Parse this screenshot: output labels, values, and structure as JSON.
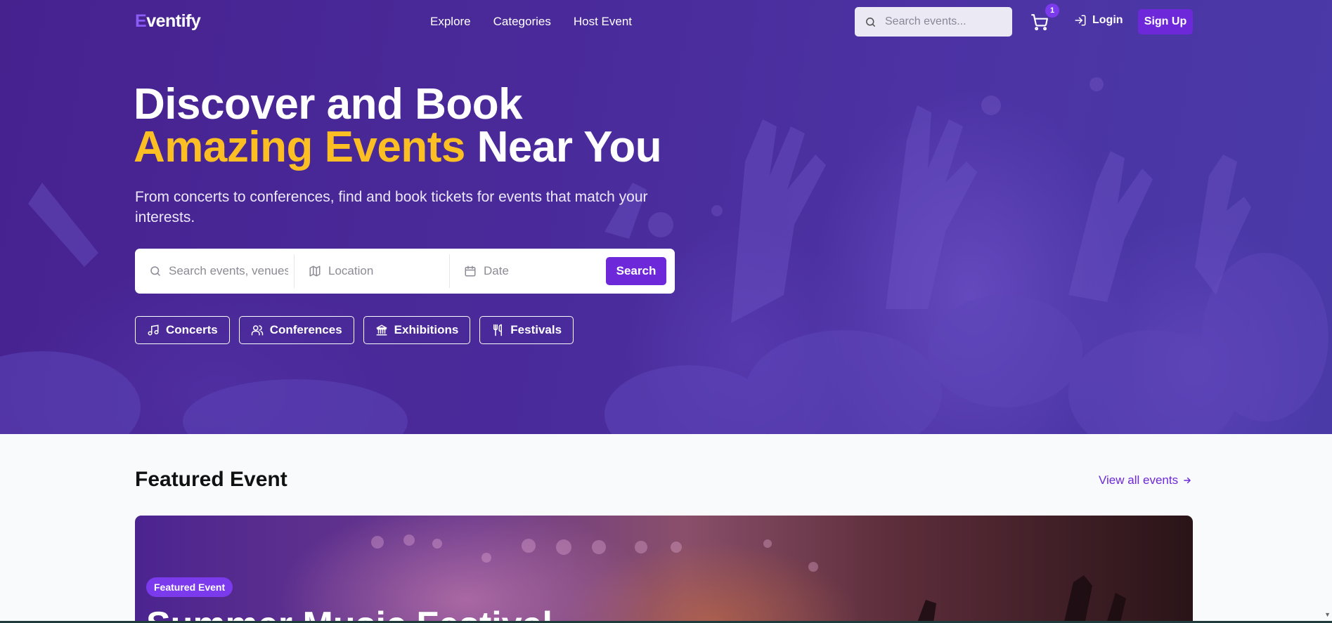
{
  "brand": {
    "logo_letter": "E",
    "logo_rest": "ventify"
  },
  "nav": {
    "links": [
      "Explore",
      "Categories",
      "Host Event"
    ],
    "search_placeholder": "Search events...",
    "cart_count": "1",
    "login_label": "Login",
    "signup_label": "Sign Up"
  },
  "hero": {
    "headline_line1": "Discover and Book",
    "headline_accent": "Amazing Events",
    "headline_rest": " Near You",
    "subtitle": "From concerts to conferences, find and book tickets for events that match your interests.",
    "search": {
      "keyword_placeholder": "Search events, venues",
      "location_placeholder": "Location",
      "date_placeholder": "Date",
      "button_label": "Search"
    },
    "categories": [
      {
        "label": "Concerts",
        "icon": "music-note-icon"
      },
      {
        "label": "Conferences",
        "icon": "users-icon"
      },
      {
        "label": "Exhibitions",
        "icon": "landmark-icon"
      },
      {
        "label": "Festivals",
        "icon": "utensils-icon"
      }
    ]
  },
  "featured": {
    "section_title": "Featured Event",
    "view_all_label": "View all events",
    "badge": "Featured Event",
    "event_title": "Summer Music Festival"
  },
  "colors": {
    "brand_purple": "#6d28d9",
    "accent_yellow": "#fbbf24",
    "hero_bg": "#4a2a9a"
  }
}
